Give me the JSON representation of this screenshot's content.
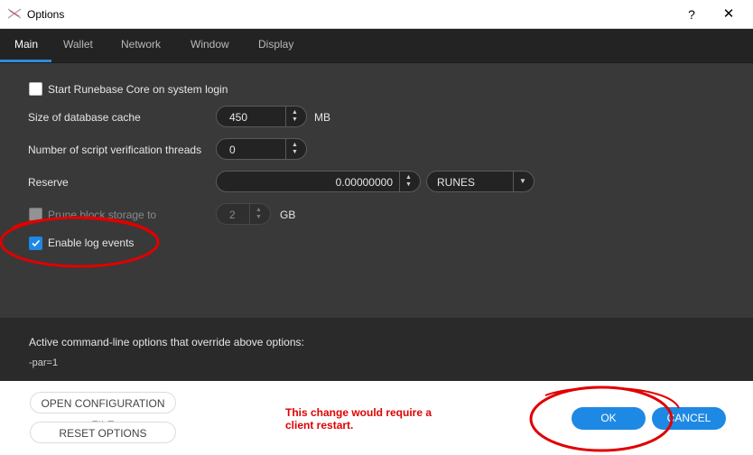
{
  "window": {
    "title": "Options",
    "help_label": "?",
    "close_label": "✕"
  },
  "tabs": [
    {
      "label": "Main",
      "active": true
    },
    {
      "label": "Wallet",
      "active": false
    },
    {
      "label": "Network",
      "active": false
    },
    {
      "label": "Window",
      "active": false
    },
    {
      "label": "Display",
      "active": false
    }
  ],
  "main": {
    "start_on_login": {
      "label": "Start Runebase Core on system login",
      "checked": false
    },
    "db_cache": {
      "label": "Size of database cache",
      "value": "450",
      "unit": "MB"
    },
    "script_threads": {
      "label": "Number of script verification threads",
      "value": "0"
    },
    "reserve": {
      "label": "Reserve",
      "value": "0.00000000",
      "currency": "RUNES"
    },
    "prune": {
      "label": "Prune block storage to",
      "value": "2",
      "unit": "GB",
      "checked": false,
      "enabled": false
    },
    "log_events": {
      "label": "Enable  log events",
      "checked": true
    }
  },
  "cmdline": {
    "title": "Active command-line options that override above options:",
    "value": "-par=1"
  },
  "footer": {
    "open_config_label": "OPEN CONFIGURATION FILE",
    "reset_label": "RESET OPTIONS",
    "warning_line1": "This change would require a",
    "warning_line2": "client restart.",
    "ok_label": "OK",
    "cancel_label": "CANCEL"
  },
  "colors": {
    "accent": "#1e88e5",
    "warning": "#e00000",
    "annotation": "#e00000"
  }
}
